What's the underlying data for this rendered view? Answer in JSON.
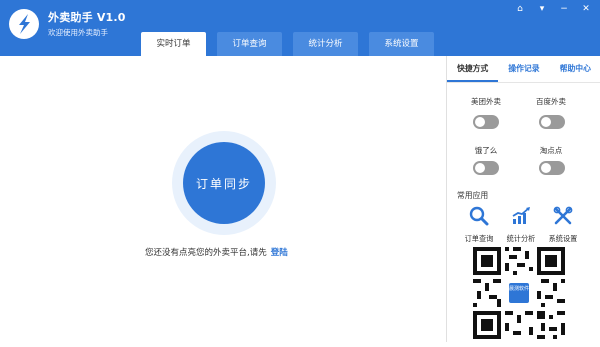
{
  "app": {
    "title": "外卖助手 V1.0",
    "subtitle": "欢迎使用外卖助手"
  },
  "titlebar": {
    "controls": {
      "home": "⌂",
      "menu": "▾",
      "minimize": "−",
      "close": "✕"
    }
  },
  "tabs": [
    {
      "label": "实时订单",
      "active": true
    },
    {
      "label": "订单查询",
      "active": false
    },
    {
      "label": "统计分析",
      "active": false
    },
    {
      "label": "系统设置",
      "active": false
    }
  ],
  "main": {
    "sync_button_label": "订单同步",
    "login_prompt": "您还没有点亮您的外卖平台,请先",
    "login_link": "登陆"
  },
  "sidebar": {
    "tabs": [
      {
        "label": "快捷方式",
        "active": true
      },
      {
        "label": "操作记录",
        "active": false
      },
      {
        "label": "帮助中心",
        "active": false
      }
    ],
    "platforms": [
      {
        "label": "美团外卖",
        "enabled": false
      },
      {
        "label": "百度外卖",
        "enabled": false
      },
      {
        "label": "饿了么",
        "enabled": false
      },
      {
        "label": "淘点点",
        "enabled": false
      }
    ],
    "common_apps_title": "常用应用",
    "apps": [
      {
        "label": "订单查询",
        "icon": "search-icon"
      },
      {
        "label": "统计分析",
        "icon": "chart-icon"
      },
      {
        "label": "系统设置",
        "icon": "tools-icon"
      }
    ],
    "qr_badge": "晨测软件"
  },
  "colors": {
    "accent": "#2e76d6",
    "toggle_off": "#9a9a9a"
  }
}
